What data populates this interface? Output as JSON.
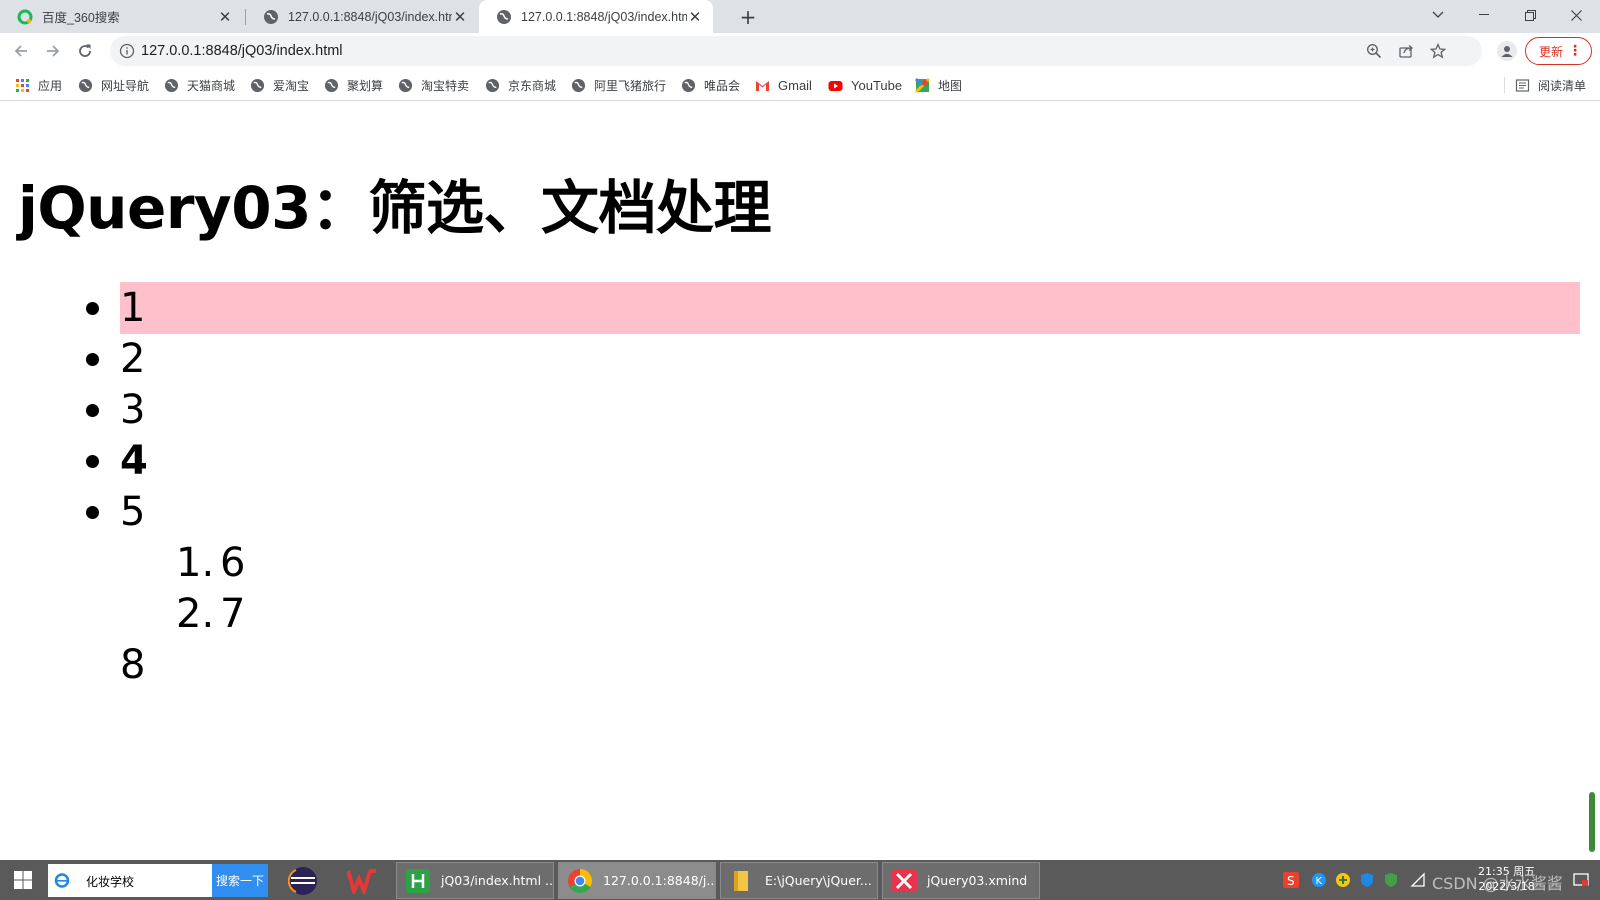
{
  "browser": {
    "tabs": [
      {
        "title": "百度_360搜索",
        "icon": "360-search-icon"
      },
      {
        "title": "127.0.0.1:8848/jQ03/index.html",
        "icon": "globe-icon"
      },
      {
        "title": "127.0.0.1:8848/jQ03/index.html",
        "icon": "globe-icon"
      }
    ],
    "active_tab": 2,
    "new_tab_label": "+",
    "url": "127.0.0.1:8848/jQ03/index.html",
    "update_label": "更新",
    "bookmarks": [
      {
        "label": "应用",
        "icon": "apps-grid-icon"
      },
      {
        "label": "网址导航",
        "icon": "globe-icon"
      },
      {
        "label": "天猫商城",
        "icon": "globe-icon"
      },
      {
        "label": "爱淘宝",
        "icon": "globe-icon"
      },
      {
        "label": "聚划算",
        "icon": "globe-icon"
      },
      {
        "label": "淘宝特卖",
        "icon": "globe-icon"
      },
      {
        "label": "京东商城",
        "icon": "globe-icon"
      },
      {
        "label": "阿里飞猪旅行",
        "icon": "globe-icon"
      },
      {
        "label": "唯品会",
        "icon": "globe-icon"
      },
      {
        "label": "Gmail",
        "icon": "gmail-icon"
      },
      {
        "label": "YouTube",
        "icon": "youtube-icon"
      },
      {
        "label": "地图",
        "icon": "maps-icon"
      }
    ],
    "reading_list_label": "阅读清单"
  },
  "page": {
    "title": "jQuery03：筛选、文档处理",
    "bullet_items": [
      "1",
      "2",
      "3",
      "4",
      "5"
    ],
    "highlighted_item": "1",
    "bold_item": "4",
    "ordered_items": [
      {
        "marker": "1.",
        "value": "6"
      },
      {
        "marker": "2.",
        "value": "7"
      }
    ],
    "trailing_item": "8",
    "colors": {
      "highlight": "#ffc0cb"
    }
  },
  "taskbar": {
    "search_text": "化妆学校",
    "search_button": "搜索一下",
    "tasks": [
      {
        "label": "jQ03/index.html ...",
        "icon": "hbuilder-icon"
      },
      {
        "label": "127.0.0.1:8848/j...",
        "icon": "chrome-icon"
      },
      {
        "label": "E:\\jQuery\\jQuer...",
        "icon": "folder-icon"
      },
      {
        "label": "jQuery03.xmind",
        "icon": "xmind-icon"
      }
    ],
    "clock_time": "21:35 周五",
    "clock_date": "2022/3/18",
    "watermark": "CSDN @水水酱酱"
  }
}
